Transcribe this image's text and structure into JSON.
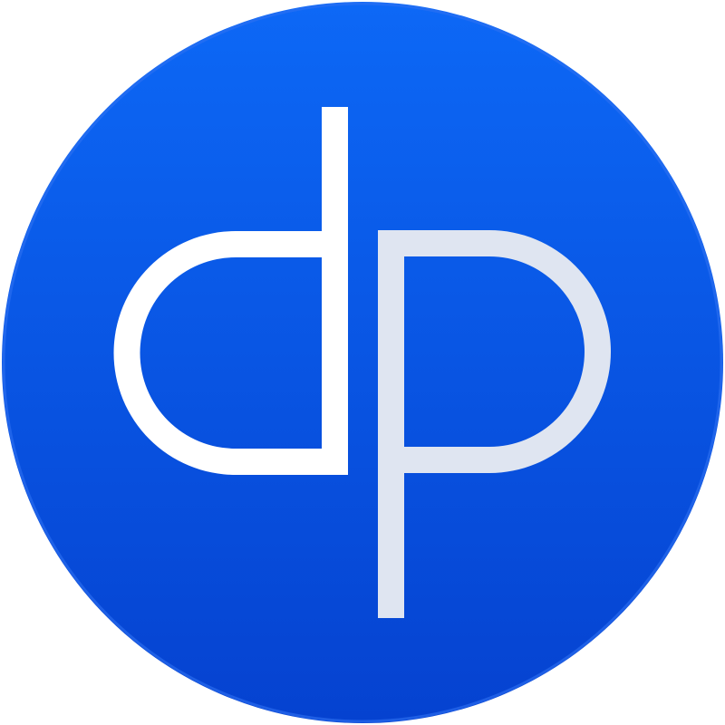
{
  "logo": {
    "text": "dp",
    "colors": {
      "background_top": "#0D68F6",
      "background_bottom": "#0542D0",
      "rim": "#2E72F2",
      "letter_d": "#FFFFFF",
      "letter_p": "#DFE5F1"
    }
  }
}
